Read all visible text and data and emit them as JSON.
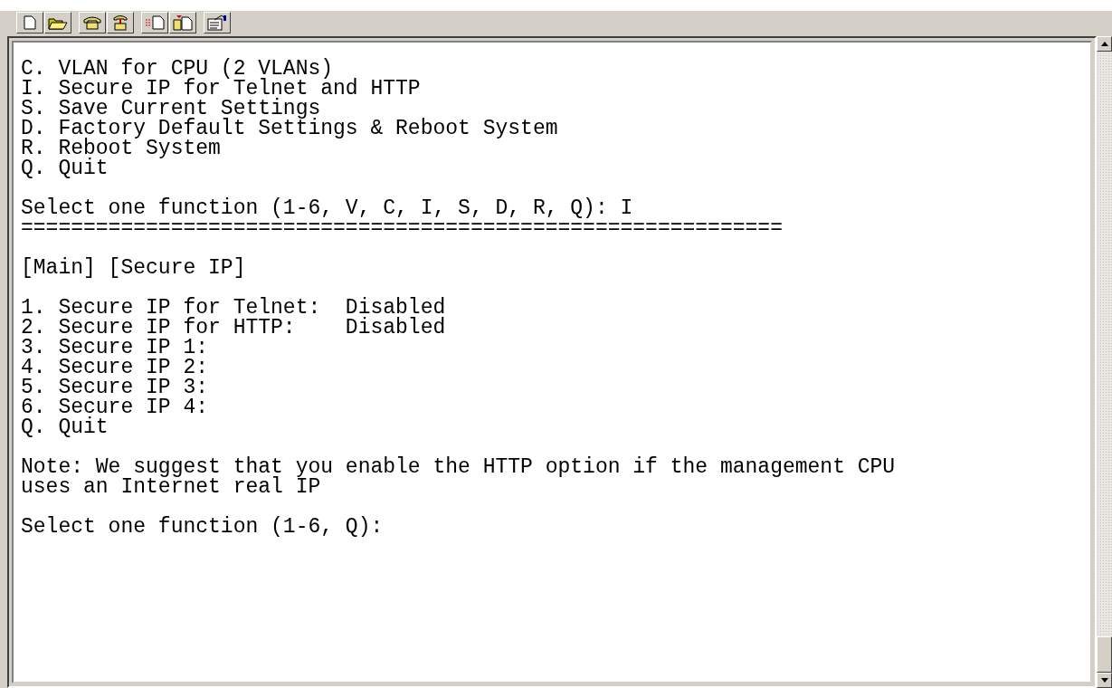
{
  "terminal": {
    "blocks": [
      [
        "C. VLAN for CPU (2 VLANs)",
        "I. Secure IP for Telnet and HTTP",
        "S. Save Current Settings",
        "D. Factory Default Settings & Reboot System",
        "R. Reboot System",
        "Q. Quit"
      ],
      [
        "Select one function (1-6, V, C, I, S, D, R, Q): I",
        "============================================================="
      ],
      [
        "[Main] [Secure IP]"
      ],
      [
        "1. Secure IP for Telnet:  Disabled",
        "2. Secure IP for HTTP:    Disabled",
        "3. Secure IP 1:",
        "4. Secure IP 2:",
        "5. Secure IP 3:",
        "6. Secure IP 4:",
        "Q. Quit"
      ],
      [
        "Note: We suggest that you enable the HTTP option if the management CPU",
        "uses an Internet real IP"
      ],
      [
        "Select one function (1-6, Q):"
      ]
    ]
  }
}
